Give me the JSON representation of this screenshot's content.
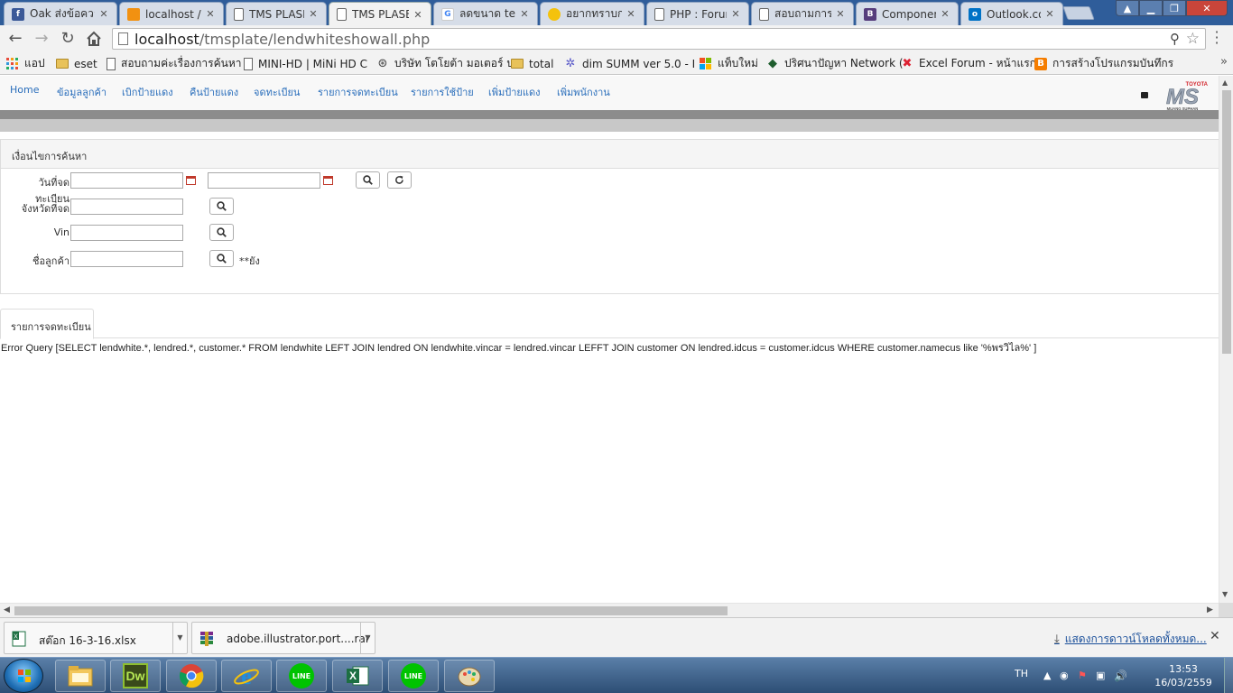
{
  "browser": {
    "tabs": [
      {
        "title": "Oak ส่งข้อความ",
        "icon": "facebook-icon",
        "color": "#3b5998",
        "glyph": "f"
      },
      {
        "title": "localhost / localhost",
        "icon": "phpmyadmin-icon",
        "color": "#f29111",
        "glyph": ""
      },
      {
        "title": "TMS PLASE",
        "icon": "page-icon",
        "color": "#ffffff",
        "glyph": ""
      },
      {
        "title": "TMS PLASE",
        "icon": "page-icon",
        "color": "#ffffff",
        "glyph": "",
        "active": true
      },
      {
        "title": "ลดขนาด text",
        "icon": "google-icon",
        "color": "#4285f4",
        "glyph": "G"
      },
      {
        "title": "อยากทราบการ",
        "icon": "emoji-icon",
        "color": "#f4c20d",
        "glyph": ""
      },
      {
        "title": "PHP : Forum",
        "icon": "page-icon",
        "color": "#ffffff",
        "glyph": ""
      },
      {
        "title": "สอบถามการ",
        "icon": "page-icon",
        "color": "#ffffff",
        "glyph": ""
      },
      {
        "title": "Components",
        "icon": "bootstrap-icon",
        "color": "#563d7c",
        "glyph": "B"
      },
      {
        "title": "Outlook.com",
        "icon": "outlook-icon",
        "color": "#0072c6",
        "glyph": "o"
      }
    ],
    "address": {
      "host": "localhost",
      "path": "/tmsplate/lendwhiteshowall.php"
    },
    "bookmarks": [
      {
        "label": "แอป",
        "icon": "apps-grid-icon"
      },
      {
        "label": "eset",
        "icon": "folder-icon"
      },
      {
        "label": "สอบถามค่ะเรื่องการค้นหา",
        "icon": "page-icon"
      },
      {
        "label": "MINI-HD | MiNi HD C",
        "icon": "page-icon"
      },
      {
        "label": "บริษัท โตโยต้า มอเตอร์ ป",
        "icon": "toyota-icon"
      },
      {
        "label": "total",
        "icon": "folder-icon"
      },
      {
        "label": "dim SUMM ver 5.0 - I",
        "icon": "gear-icon"
      },
      {
        "label": "แท็บใหม่",
        "icon": "windows-icon"
      },
      {
        "label": "ปริศนาปัญหา Network (",
        "icon": "diamond-icon"
      },
      {
        "label": "Excel Forum - หน้าแรก",
        "icon": "excel-forum-icon"
      },
      {
        "label": "การสร้างโปรแกรมบันทึกร",
        "icon": "blogger-icon"
      }
    ]
  },
  "site": {
    "nav": [
      "Home",
      "ข้อมูลลูกค้า",
      "เบิกป้ายแดง",
      "คืนป้ายแดง",
      "จดทะเบียน",
      "รายการจดทะเบียน",
      "รายการใช้ป้าย",
      "เพิ่มป้ายแดง",
      "เพิ่มพนักงาน"
    ],
    "logo": {
      "brand": "TOYOTA",
      "mark": "MS",
      "sub": "MUANG SUPHAN"
    }
  },
  "search": {
    "header": "เงื่อนไขการค้นหา",
    "fields": [
      {
        "label": "วันที่จดทะเบียน",
        "value": "",
        "value2": ""
      },
      {
        "label": "จังหวัดที่จด",
        "value": ""
      },
      {
        "label": "Vin",
        "value": ""
      },
      {
        "label": "ชื่อลูกค้า",
        "value": ""
      }
    ],
    "note": "**ยัง"
  },
  "results": {
    "tab": "รายการจดทะเบียน",
    "error": "Error Query [SELECT lendwhite.*, lendred.*, customer.* FROM lendwhite LEFT JOIN lendred ON lendwhite.vincar = lendred.vincar LEFFT JOIN customer ON lendred.idcus = customer.idcus WHERE customer.namecus like '%พรวิไล%' ]"
  },
  "downloads": {
    "items": [
      {
        "name": "สต๊อก 16-3-16.xlsx",
        "icon": "excel-file-icon"
      },
      {
        "name": "adobe.illustrator.port....rar",
        "icon": "rar-file-icon"
      }
    ],
    "show_all": "แสดงการดาวน์โหลดทั้งหมด..."
  },
  "taskbar": {
    "apps": [
      "explorer-icon",
      "dreamweaver-icon",
      "chrome-icon",
      "ie-icon",
      "line-icon",
      "excel-icon",
      "line-icon",
      "paint-icon"
    ],
    "dw_glyph": "Dw",
    "line_label": "LINE",
    "lang": "TH",
    "time": "13:53",
    "date": "16/03/2559"
  },
  "colors": {
    "link": "#2a6ebb",
    "chrome_frame": "#2f5d9a",
    "logo_red": "#d2232a"
  }
}
